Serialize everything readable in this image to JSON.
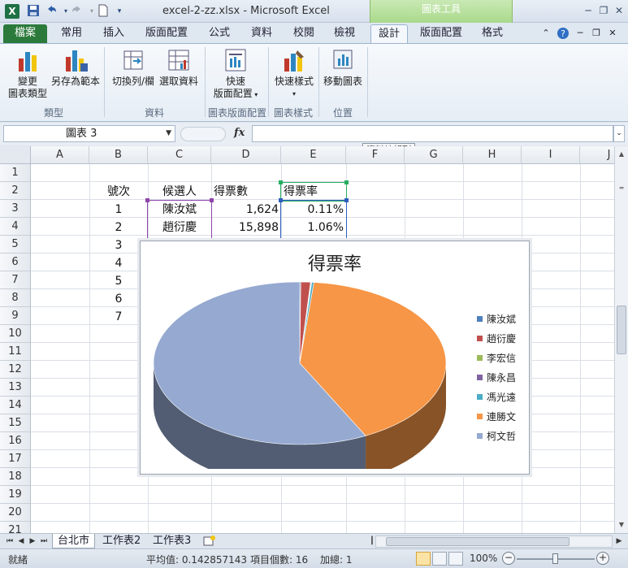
{
  "window": {
    "title": "excel-2-zz.xlsx - Microsoft Excel",
    "contextual_band": "圖表工具"
  },
  "quick_access": {
    "save_icon": "save-icon",
    "undo_icon": "undo-icon",
    "redo_icon": "redo-icon",
    "new_icon": "new-document-icon"
  },
  "tabs": {
    "file": "檔案",
    "home": "常用",
    "insert": "插入",
    "page_layout": "版面配置",
    "formulas": "公式",
    "data": "資料",
    "review": "校閱",
    "view": "檢視",
    "design": "設計",
    "layout": "版面配置",
    "format": "格式"
  },
  "ribbon": {
    "change_type_l1": "變更",
    "change_type_l2": "圖表類型",
    "save_template": "另存為範本",
    "switch_row_col": "切換列/欄",
    "select_data": "選取資料",
    "quick_layout_l1": "快速",
    "quick_layout_l2": "版面配置",
    "quick_styles": "快速樣式",
    "move_chart": "移動圖表",
    "group_type": "類型",
    "group_data": "資料",
    "group_layouts": "圖表版面配置",
    "group_styles": "圖表樣式",
    "group_location": "位置"
  },
  "formula_bar": {
    "name_box": "圖表 3",
    "fx": "fx",
    "formula": ""
  },
  "tooltip": "資料編輯列",
  "columns": [
    "A",
    "B",
    "C",
    "D",
    "E",
    "F",
    "G",
    "H",
    "I",
    "J"
  ],
  "rows": [
    "1",
    "2",
    "3",
    "4",
    "5",
    "6",
    "7",
    "8",
    "9",
    "10",
    "11",
    "12",
    "13",
    "14",
    "15",
    "16",
    "17",
    "18",
    "19",
    "20",
    "21"
  ],
  "sheet": {
    "header_no": "號次",
    "header_candidate": "候選人",
    "header_votes": "得票數",
    "header_rate": "得票率",
    "row3": {
      "no": "1",
      "name": "陳汝斌",
      "votes": "1,624",
      "rate": "0.11%"
    },
    "row4": {
      "no": "2",
      "name": "趙衍慶",
      "votes": "15,898",
      "rate": "1.06%"
    },
    "row5": {
      "no": "3"
    },
    "row6": {
      "no": "4"
    },
    "row7": {
      "no": "5"
    },
    "row8": {
      "no": "6"
    },
    "row9": {
      "no": "7"
    }
  },
  "chart_data": {
    "type": "pie",
    "title": "得票率",
    "categories": [
      "陳汝斌",
      "趙衍慶",
      "李宏信",
      "陳永昌",
      "馮光遠",
      "連勝文",
      "柯文哲"
    ],
    "values": [
      0.11,
      1.06,
      0.07,
      0.06,
      0.24,
      40.82,
      57.16
    ],
    "colors": [
      "#4f81bd",
      "#c0504d",
      "#9bbb59",
      "#8064a2",
      "#4bacc6",
      "#f79646",
      "#95a9d1"
    ],
    "legend_position": "right",
    "three_d": true
  },
  "sheet_tabs": [
    "台北市",
    "工作表2",
    "工作表3"
  ],
  "status": {
    "ready": "就緒",
    "average": "平均值: 0.142857143",
    "count": "項目個數: 16",
    "sum": "加總: 1",
    "zoom": "100%"
  }
}
